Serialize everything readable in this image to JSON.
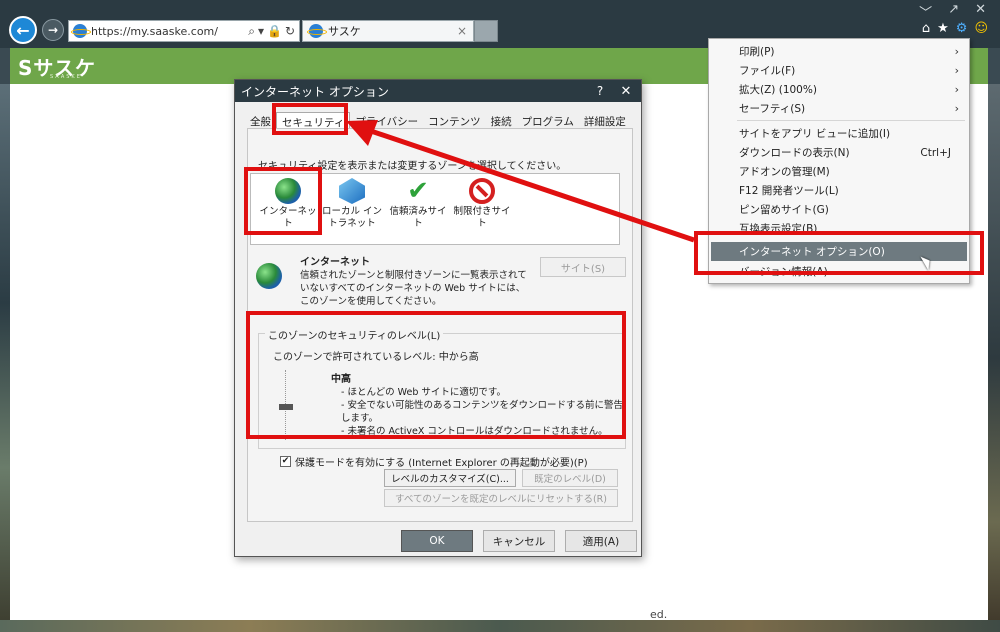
{
  "browser": {
    "address": "https://my.saaske.com/",
    "tab_title": "サスケ",
    "tab_close": "×",
    "back_glyph": "←",
    "forward_glyph": "→",
    "address_tools": [
      "⌕",
      "▾",
      "🔒",
      "↻"
    ],
    "window_controls": [
      "﹀",
      "↗",
      "✕"
    ],
    "toolbar_icons": [
      "⌂",
      "★",
      "⚙",
      "☺"
    ]
  },
  "site": {
    "logo": "サスケ",
    "logo_mark": "S",
    "logo_sub": "SAASKE",
    "footer_fragment": "ed."
  },
  "dialog": {
    "title": "インターネット オプション",
    "help": "?",
    "close": "✕",
    "tabs": [
      {
        "label": "全般"
      },
      {
        "label": "セキュリティ"
      },
      {
        "label": "プライバシー"
      },
      {
        "label": "コンテンツ"
      },
      {
        "label": "接続"
      },
      {
        "label": "プログラム"
      },
      {
        "label": "詳細設定"
      }
    ],
    "zone_caption": "セキュリティ設定を表示または変更するゾーンを選択してください。",
    "zones": [
      {
        "label": "インターネット"
      },
      {
        "label": "ローカル イントラネット"
      },
      {
        "label": "信頼済みサイト"
      },
      {
        "label": "制限付きサイト"
      }
    ],
    "zone_name": "インターネット",
    "zone_description": "信頼されたゾーンと制限付きゾーンに一覧表示されていないすべてのインターネットの Web サイトには、このゾーンを使用してください。",
    "sites_button": "サイト(S)",
    "level_legend": "このゾーンのセキュリティのレベル(L)",
    "level_allowed": "このゾーンで許可されているレベル: 中から高",
    "level_name": "中高",
    "level_bullets": [
      "- ほとんどの Web サイトに適切です。",
      "- 安全でない可能性のあるコンテンツをダウンロードする前に警告します。",
      "- 未署名の ActiveX コントロールはダウンロードされません。"
    ],
    "protected_mode_label": "保護モードを有効にする (Internet Explorer の再起動が必要)(P)",
    "protected_mode_checked": "✔",
    "custom_level_button": "レベルのカスタマイズ(C)...",
    "default_level_button": "既定のレベル(D)",
    "reset_all_button": "すべてのゾーンを既定のレベルにリセットする(R)",
    "ok_button": "OK",
    "cancel_button": "キャンセル",
    "apply_button": "適用(A)"
  },
  "tools_menu": {
    "items": [
      {
        "label": "印刷(P)",
        "submenu": "›"
      },
      {
        "label": "ファイル(F)",
        "submenu": "›"
      },
      {
        "label": "拡大(Z) (100%)",
        "submenu": "›"
      },
      {
        "label": "セーフティ(S)",
        "submenu": "›"
      },
      {
        "label": "サイトをアプリ ビューに追加(I)"
      },
      {
        "label": "ダウンロードの表示(N)",
        "shortcut": "Ctrl+J"
      },
      {
        "label": "アドオンの管理(M)"
      },
      {
        "label": "F12 開発者ツール(L)"
      },
      {
        "label": "ピン留めサイト(G)"
      },
      {
        "label": "互換表示設定(B)"
      },
      {
        "label": "インターネット オプション(O)"
      },
      {
        "label": "バージョン情報(A)"
      }
    ]
  },
  "colors": {
    "annotation": "#e01010",
    "site_header": "#6fa64a",
    "chrome": "#2b3a42",
    "menu_highlight": "#6e7a80"
  }
}
